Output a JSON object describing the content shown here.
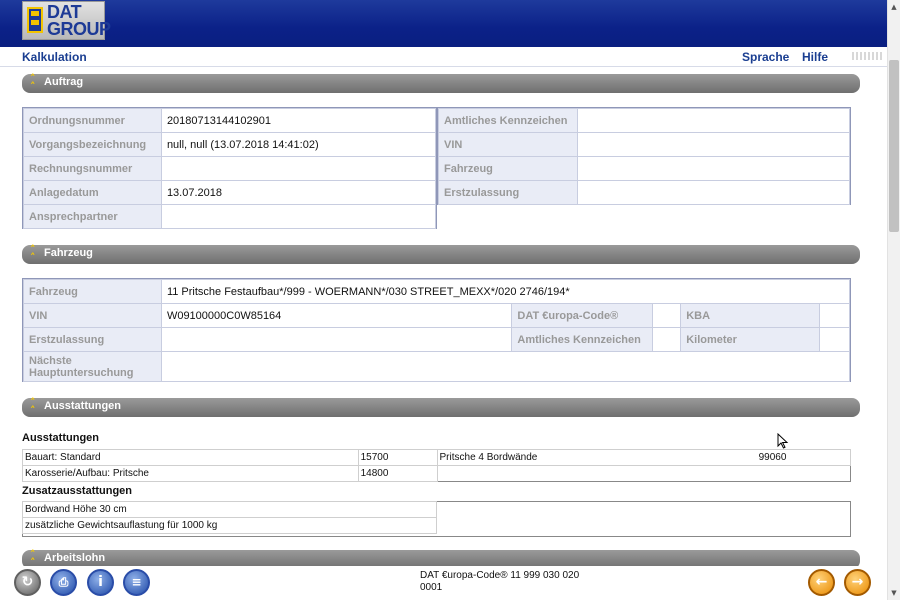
{
  "brand": {
    "logo_line1": "DAT",
    "logo_line2": "GROUP"
  },
  "menu": {
    "left": "Kalkulation",
    "language": "Sprache",
    "help": "Hilfe"
  },
  "sections": {
    "auftrag": "Auftrag",
    "fahrzeug": "Fahrzeug",
    "ausstattungen": "Ausstattungen",
    "arbeitslohn": "Arbeitslohn"
  },
  "auftrag": {
    "left": [
      {
        "label": "Ordnungsnummer",
        "value": "20180713144102901"
      },
      {
        "label": "Vorgangsbezeichnung",
        "value": "null, null (13.07.2018 14:41:02)"
      },
      {
        "label": "Rechnungsnummer",
        "value": ""
      },
      {
        "label": "Anlagedatum",
        "value": "13.07.2018"
      },
      {
        "label": "Ansprechpartner",
        "value": ""
      }
    ],
    "right": [
      {
        "label": "Amtliches Kennzeichen",
        "value": ""
      },
      {
        "label": "VIN",
        "value": ""
      },
      {
        "label": "Fahrzeug",
        "value": ""
      },
      {
        "label": "Erstzulassung",
        "value": ""
      }
    ]
  },
  "fahrzeug": {
    "fahrzeug_label": "Fahrzeug",
    "fahrzeug_value": "11 Pritsche Festaufbau*/999 - WOERMANN*/030 STREET_MEXX*/020 2746/194*",
    "vin_label": "VIN",
    "vin_value": "W09100000C0W85164",
    "europa_label": "DAT €uropa-Code®",
    "europa_value": "",
    "kba_label": "KBA",
    "kba_value": "",
    "erstzulassung_label": "Erstzulassung",
    "erstzulassung_value": "",
    "kennzeichen_label": "Amtliches Kennzeichen",
    "kennzeichen_value": "",
    "kilometer_label": "Kilometer",
    "kilometer_value": "",
    "hu_label": "Nächste Hauptuntersuchung",
    "hu_value": ""
  },
  "ausstattungen": {
    "heading": "Ausstattungen",
    "rows": [
      {
        "left_name": "Bauart: Standard",
        "left_code": "15700",
        "right_name": "Pritsche 4 Bordwände",
        "right_code": "99060"
      },
      {
        "left_name": "Karosserie/Aufbau: Pritsche",
        "left_code": "14800",
        "right_name": "",
        "right_code": ""
      }
    ],
    "zusatz_heading": "Zusatzausstattungen",
    "zusatz_rows": [
      "Bordwand Höhe 30 cm",
      "zusätzliche Gewichtsauflastung für 1000 kg"
    ]
  },
  "footer": {
    "europa_line1": "DAT €uropa-Code® 11 999 030 020",
    "europa_line2": "0001",
    "buttons": [
      "refresh-icon",
      "print-icon",
      "info-icon",
      "document-icon",
      "back-icon",
      "forward-icon"
    ]
  }
}
